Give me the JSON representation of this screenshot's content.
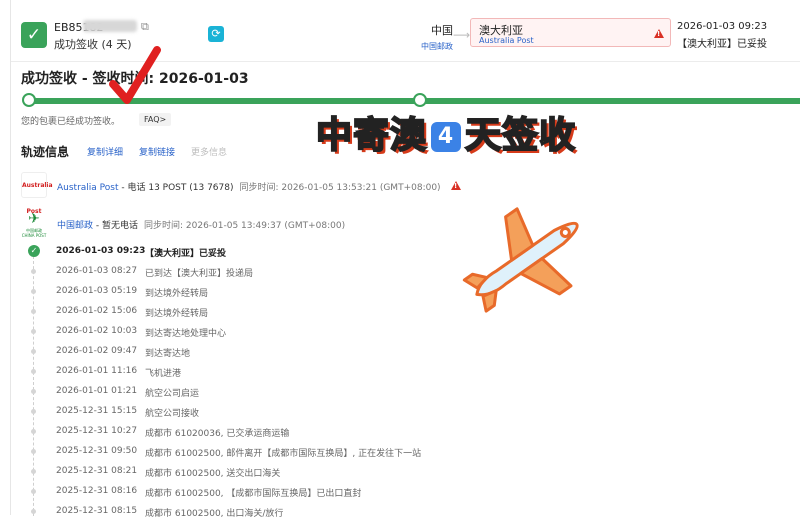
{
  "header": {
    "tracking_prefix": "EB85182",
    "copy_icon": "copy-icon",
    "status": "成功签收 (4 天)",
    "origin_country": "中国",
    "origin_post": "中国邮政",
    "dest_country": "澳大利亚",
    "dest_post": "Australia Post",
    "last_time": "2026-01-03 09:23",
    "last_event": "【澳大利亚】已妥投"
  },
  "summary": {
    "title": "成功签收 - 签收时间: 2026-01-03",
    "subline": "您的包裹已经成功签收。",
    "faq": "FAQ>"
  },
  "track": {
    "title": "轨迹信息",
    "copy_detail": "复制详细",
    "copy_link": "复制链接",
    "more": "更多信息"
  },
  "carriers": [
    {
      "logo": "Australia Post",
      "name": "Australia Post",
      "phone": " - 电话 13 POST (13 7678)",
      "sync": "同步时间: 2026-01-05 13:53:21 (GMT+08:00)"
    },
    {
      "logo": "中国邮政",
      "logo_sub": "CHINA POST",
      "name": "中国邮政",
      "phone": " - 暂无电话",
      "sync": "同步时间: 2026-01-05 13:49:37 (GMT+08:00)"
    }
  ],
  "events": [
    {
      "time": "2026-01-03 09:23",
      "desc": "【澳大利亚】已妥投"
    },
    {
      "time": "2026-01-03 08:27",
      "desc": "已到达【澳大利亚】投递局"
    },
    {
      "time": "2026-01-03 05:19",
      "desc": "到达境外经转局"
    },
    {
      "time": "2026-01-02 15:06",
      "desc": "到达境外经转局"
    },
    {
      "time": "2026-01-02 10:03",
      "desc": "到达寄达地处理中心"
    },
    {
      "time": "2026-01-02 09:47",
      "desc": "到达寄达地"
    },
    {
      "time": "2026-01-01 11:16",
      "desc": "飞机进港"
    },
    {
      "time": "2026-01-01 01:21",
      "desc": "航空公司启运"
    },
    {
      "time": "2025-12-31 15:15",
      "desc": "航空公司接收"
    },
    {
      "time": "2025-12-31 10:27",
      "desc": "成都市 61020036, 已交承运商运输"
    },
    {
      "time": "2025-12-31 09:50",
      "desc": "成都市 61002500, 邮件离开【成都市国际互换局】, 正在发往下一站"
    },
    {
      "time": "2025-12-31 08:21",
      "desc": "成都市 61002500, 送交出口海关"
    },
    {
      "time": "2025-12-31 08:16",
      "desc": "成都市 61002500, 【成都市国际互换局】已出口直封"
    },
    {
      "time": "2025-12-31 08:15",
      "desc": "成都市 61002500, 出口海关/放行"
    }
  ],
  "banner": {
    "pre": "中寄澳",
    "num": "4",
    "post": "天签收"
  },
  "colors": {
    "green": "#3aa35a",
    "link": "#2a63c9",
    "warn": "#d93025",
    "banner": "#ffd21f"
  }
}
